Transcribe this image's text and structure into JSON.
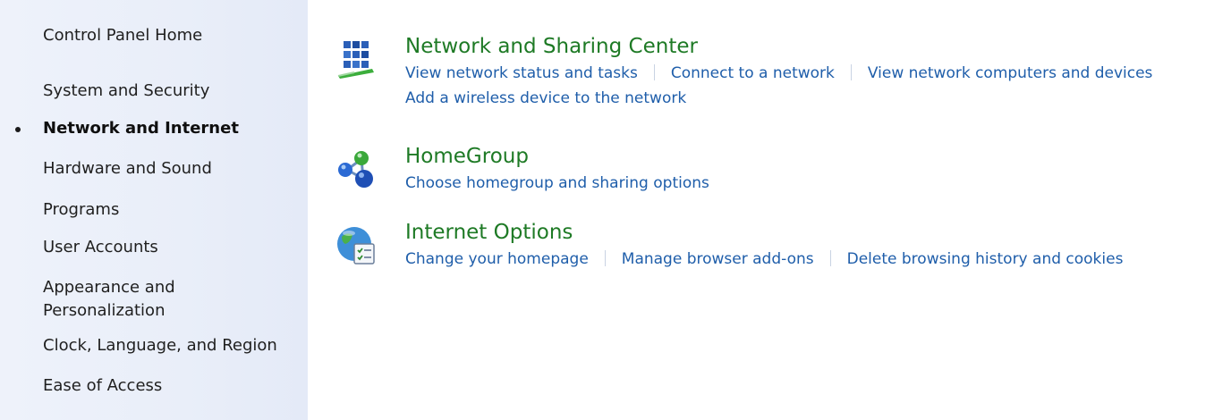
{
  "sidebar": {
    "items": [
      {
        "label": "Control Panel Home"
      },
      {
        "label": "System and Security"
      },
      {
        "label": "Network and Internet"
      },
      {
        "label": "Hardware and Sound"
      },
      {
        "label": "Programs"
      },
      {
        "label": "User Accounts"
      },
      {
        "label": "Appearance and",
        "label2": "Personalization"
      },
      {
        "label": "Clock, Language, and Region"
      },
      {
        "label": "Ease of Access"
      }
    ],
    "active_item": "Network and Internet"
  },
  "main": {
    "categories": [
      {
        "title": "Network and Sharing Center",
        "icon": "network-sharing-icon",
        "links": [
          "View network status and tasks",
          "Connect to a network",
          "View network computers and devices",
          "Add a wireless device to the network"
        ]
      },
      {
        "title": "HomeGroup",
        "icon": "homegroup-icon",
        "links": [
          "Choose homegroup and sharing options"
        ]
      },
      {
        "title": "Internet Options",
        "icon": "internet-options-icon",
        "links": [
          "Change your homepage",
          "Manage browser add-ons",
          "Delete browsing history and cookies"
        ]
      }
    ]
  },
  "colors": {
    "title_green": "#1e7a25",
    "link_blue": "#1f5eaa",
    "sidebar_bg": "#e9eef9"
  }
}
